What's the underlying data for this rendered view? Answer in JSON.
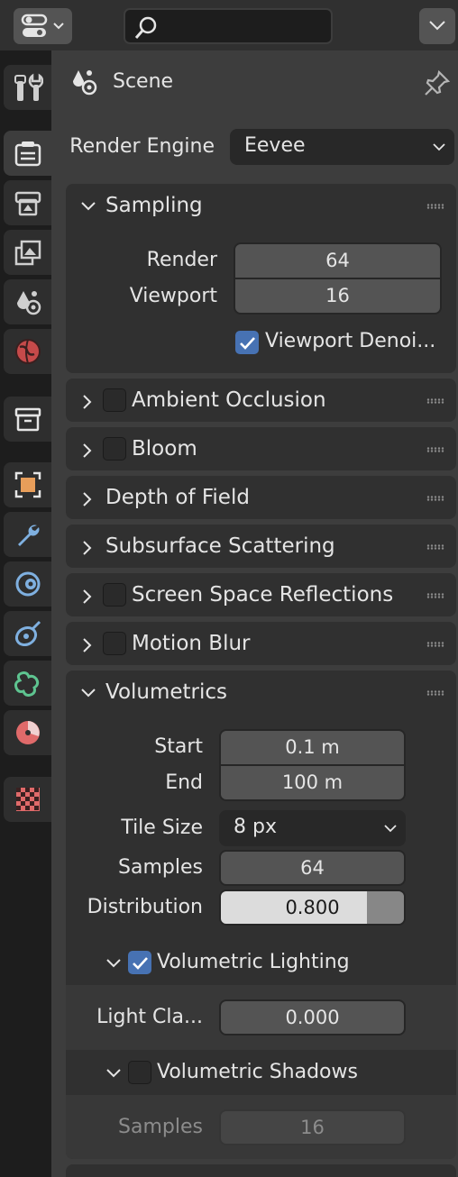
{
  "header": {
    "editor_type_icon": "properties-editor-icon",
    "search_icon": "search-icon",
    "search_placeholder": "",
    "options_icon": "chevron-down-icon"
  },
  "tabs": [
    {
      "name": "tool",
      "icon": "tool-icon"
    },
    {
      "name": "render",
      "icon": "render-icon",
      "active": true
    },
    {
      "name": "output",
      "icon": "output-icon"
    },
    {
      "name": "view-layer",
      "icon": "view-layer-icon"
    },
    {
      "name": "scene",
      "icon": "scene-icon"
    },
    {
      "name": "world",
      "icon": "world-icon"
    },
    {
      "name": "collection",
      "icon": "collection-icon"
    },
    {
      "name": "object",
      "icon": "object-icon"
    },
    {
      "name": "modifier",
      "icon": "wrench-icon"
    },
    {
      "name": "particles",
      "icon": "particles-icon"
    },
    {
      "name": "physics",
      "icon": "physics-icon"
    },
    {
      "name": "constraints",
      "icon": "constraints-icon"
    },
    {
      "name": "data",
      "icon": "data-icon"
    },
    {
      "name": "texture",
      "icon": "texture-icon"
    }
  ],
  "context": {
    "label": "Scene",
    "icon": "scene-icon",
    "pin_icon": "pin-icon"
  },
  "render_engine": {
    "label": "Render Engine",
    "value": "Eevee"
  },
  "sampling": {
    "title": "Sampling",
    "render_label": "Render",
    "render_value": "64",
    "viewport_label": "Viewport",
    "viewport_value": "16",
    "denoise_label": "Viewport Denoi...",
    "denoise_checked": true
  },
  "collapsed_sections": {
    "ambient_occlusion": "Ambient Occlusion",
    "bloom": "Bloom",
    "depth_of_field": "Depth of Field",
    "subsurface_scattering": "Subsurface Scattering",
    "screen_space_reflections": "Screen Space Reflections",
    "motion_blur": "Motion Blur"
  },
  "volumetrics": {
    "title": "Volumetrics",
    "start_label": "Start",
    "start_value": "0.1 m",
    "end_label": "End",
    "end_value": "100 m",
    "tile_size_label": "Tile Size",
    "tile_size_value": "8 px",
    "samples_label": "Samples",
    "samples_value": "64",
    "distribution_label": "Distribution",
    "distribution_value": "0.800",
    "distribution_fraction": 0.8,
    "lighting": {
      "title": "Volumetric Lighting",
      "checked": true,
      "light_clamp_label": "Light Cla...",
      "light_clamp_value": "0.000"
    },
    "shadows": {
      "title": "Volumetric Shadows",
      "checked": false,
      "samples_label": "Samples",
      "samples_value": "16"
    }
  },
  "colors": {
    "accent": "#4772b3",
    "panel": "#303030",
    "field": "#545454"
  }
}
